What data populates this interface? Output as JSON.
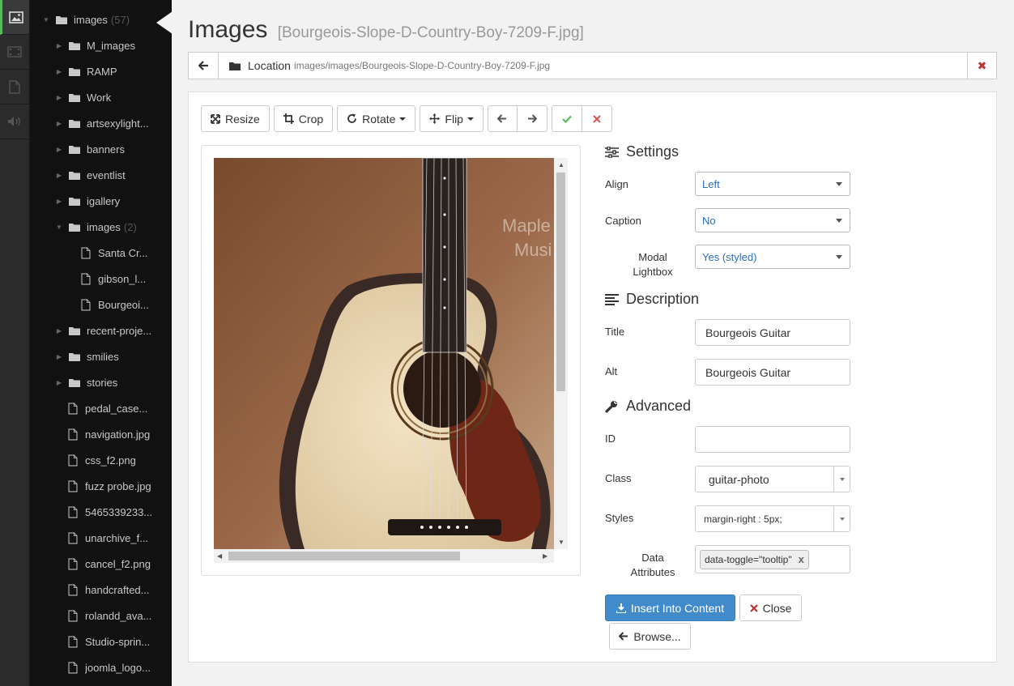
{
  "sidebar": {
    "items": [
      {
        "label": "images",
        "count": "(57)",
        "type": "folder",
        "expanded": true,
        "level": 0
      },
      {
        "label": "M_images",
        "type": "folder",
        "level": 1
      },
      {
        "label": "RAMP",
        "type": "folder",
        "level": 1
      },
      {
        "label": "Work",
        "type": "folder",
        "level": 1
      },
      {
        "label": "artsexylight...",
        "type": "folder",
        "level": 1
      },
      {
        "label": "banners",
        "type": "folder",
        "level": 1
      },
      {
        "label": "eventlist",
        "type": "folder",
        "level": 1
      },
      {
        "label": "igallery",
        "type": "folder",
        "level": 1
      },
      {
        "label": "images",
        "count": "(2)",
        "type": "folder",
        "expanded": true,
        "level": 1
      },
      {
        "label": "Santa Cr...",
        "type": "file",
        "level": 2
      },
      {
        "label": "gibson_l...",
        "type": "file",
        "level": 2
      },
      {
        "label": "Bourgeoi...",
        "type": "file",
        "level": 2
      },
      {
        "label": "recent-proje...",
        "type": "folder",
        "level": 1
      },
      {
        "label": "smilies",
        "type": "folder",
        "level": 1
      },
      {
        "label": "stories",
        "type": "folder",
        "level": 1
      },
      {
        "label": "pedal_case...",
        "type": "file",
        "level": 1
      },
      {
        "label": "navigation.jpg",
        "type": "file",
        "level": 1
      },
      {
        "label": "css_f2.png",
        "type": "file",
        "level": 1
      },
      {
        "label": "fuzz probe.jpg",
        "type": "file",
        "level": 1
      },
      {
        "label": "5465339233...",
        "type": "file",
        "level": 1
      },
      {
        "label": "unarchive_f...",
        "type": "file",
        "level": 1
      },
      {
        "label": "cancel_f2.png",
        "type": "file",
        "level": 1
      },
      {
        "label": "handcrafted...",
        "type": "file",
        "level": 1
      },
      {
        "label": "rolandd_ava...",
        "type": "file",
        "level": 1
      },
      {
        "label": "Studio-sprin...",
        "type": "file",
        "level": 1
      },
      {
        "label": "joomla_logo...",
        "type": "file",
        "level": 1
      }
    ]
  },
  "header": {
    "title": "Images",
    "subtitle": "[Bourgeois-Slope-D-Country-Boy-7209-F.jpg]"
  },
  "location": {
    "label": "Location",
    "path": "images/images/Bourgeois-Slope-D-Country-Boy-7209-F.jpg"
  },
  "toolbar": {
    "resize": "Resize",
    "crop": "Crop",
    "rotate": "Rotate",
    "flip": "Flip"
  },
  "preview": {
    "watermark_line1": "Maple",
    "watermark_line2": "Musi"
  },
  "settings": {
    "heading": "Settings",
    "align_label": "Align",
    "align_value": "Left",
    "caption_label": "Caption",
    "caption_value": "No",
    "modal_label_1": "Modal",
    "modal_label_2": "Lightbox",
    "modal_value": "Yes (styled)"
  },
  "description": {
    "heading": "Description",
    "title_label": "Title",
    "title_value": "Bourgeois Guitar",
    "alt_label": "Alt",
    "alt_value": "Bourgeois Guitar"
  },
  "advanced": {
    "heading": "Advanced",
    "id_label": "ID",
    "id_value": "",
    "class_label": "Class",
    "class_value": "guitar-photo",
    "styles_label": "Styles",
    "styles_value": "margin-right : 5px;",
    "data_label_1": "Data",
    "data_label_2": "Attributes",
    "data_tag": "data-toggle=\"tooltip\"",
    "data_tag_remove": "x"
  },
  "actions": {
    "insert": "Insert Into Content",
    "close": "Close",
    "browse": "Browse..."
  },
  "colors": {
    "primary": "#428bca",
    "danger": "#b33333",
    "success": "#5cb85c",
    "sidebar_bg": "#111111"
  }
}
